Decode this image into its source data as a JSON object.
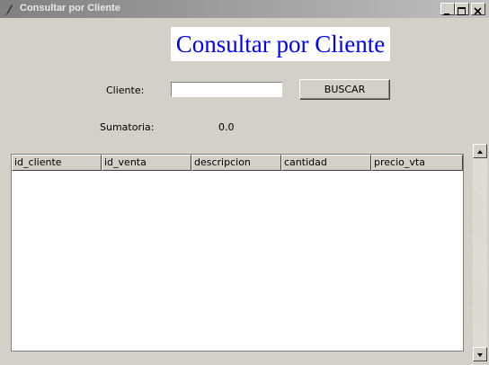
{
  "window": {
    "title": "Consultar por Cliente",
    "controls": {
      "minimize": "minimize-icon",
      "maximize": "maximize-icon",
      "close": "close-icon"
    }
  },
  "header": {
    "title": "Consultar por Cliente",
    "color": "#0000ff"
  },
  "form": {
    "cliente_label": "Cliente:",
    "cliente_value": "",
    "buscar_label": "BUSCAR"
  },
  "summary": {
    "label": "Sumatoria:",
    "value": "0.0"
  },
  "table": {
    "columns": [
      "id_cliente",
      "id_venta",
      "descripcion",
      "cantidad",
      "precio_vta"
    ],
    "rows": []
  }
}
